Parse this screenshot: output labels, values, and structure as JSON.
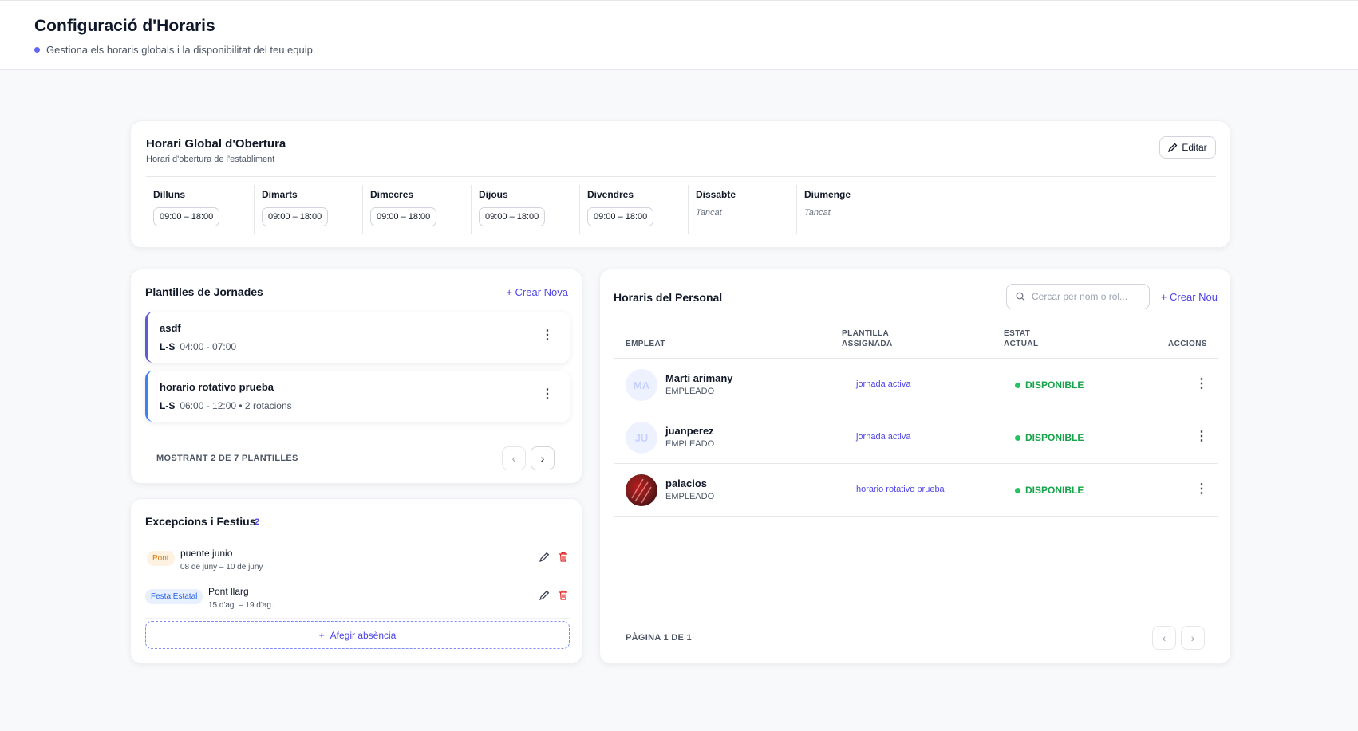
{
  "header": {
    "title": "Configuració d'Horaris",
    "subtitle": "Gestiona els horaris globals i la disponibilitat del teu equip."
  },
  "global": {
    "title": "Horari Global d'Obertura",
    "subtitle": "Horari d'obertura de l'establiment",
    "edit_label": "Editar",
    "days": [
      {
        "name": "Dilluns",
        "hours": "09:00 – 18:00",
        "closed": false
      },
      {
        "name": "Dimarts",
        "hours": "09:00 – 18:00",
        "closed": false
      },
      {
        "name": "Dimecres",
        "hours": "09:00 – 18:00",
        "closed": false
      },
      {
        "name": "Dijous",
        "hours": "09:00 – 18:00",
        "closed": false
      },
      {
        "name": "Divendres",
        "hours": "09:00 – 18:00",
        "closed": false
      },
      {
        "name": "Dissabte",
        "hours": "Tancat",
        "closed": true
      },
      {
        "name": "Diumenge",
        "hours": "Tancat",
        "closed": true
      }
    ]
  },
  "templates": {
    "title": "Plantilles de Jornades",
    "create_label": "+ Crear Nova",
    "items": [
      {
        "name": "asdf",
        "days": "L-S",
        "time": "04:00 - 07:00"
      },
      {
        "name": "horario rotativo prueba",
        "days": "L-S",
        "time": "06:00 - 12:00 • 2 rotacions"
      }
    ],
    "pager_text": "MOSTRANT 2 DE 7 PLANTILLES"
  },
  "exceptions": {
    "title": "Excepcions i Festius",
    "count": "2",
    "items": [
      {
        "badge": "Pont",
        "name": "puente junio",
        "dates": "08 de juny – 10 de juny"
      },
      {
        "badge": "Festa Estatal",
        "name": "Pont llarg",
        "dates": "15 d'ag. – 19 d'ag."
      }
    ],
    "add_label": "Afegir absència"
  },
  "staff": {
    "title": "Horaris del Personal",
    "search_placeholder": "Cercar per nom o rol...",
    "create_label": "+ Crear Nou",
    "columns": {
      "employee": "EMPLEAT",
      "template_1": "PLANTILLA",
      "template_2": "ASSIGNADA",
      "status_1": "ESTAT",
      "status_2": "ACTUAL",
      "actions": "ACCIONS"
    },
    "rows": [
      {
        "initials": "MA",
        "name": "Marti arimany",
        "role": "EMPLEADO",
        "template": "jornada activa",
        "status": "DISPONIBLE"
      },
      {
        "initials": "JU",
        "name": "juanperez",
        "role": "EMPLEADO",
        "template": "jornada activa",
        "status": "DISPONIBLE"
      },
      {
        "initials": "",
        "name": "palacios",
        "role": "EMPLEADO",
        "template": "horario rotativo prueba",
        "status": "DISPONIBLE"
      }
    ],
    "pager_text": "PÀGINA 1 DE 1"
  },
  "colors": {
    "accent": "#4f46e5",
    "success": "#16a34a",
    "danger": "#dc2626",
    "warning": "#d97706"
  }
}
